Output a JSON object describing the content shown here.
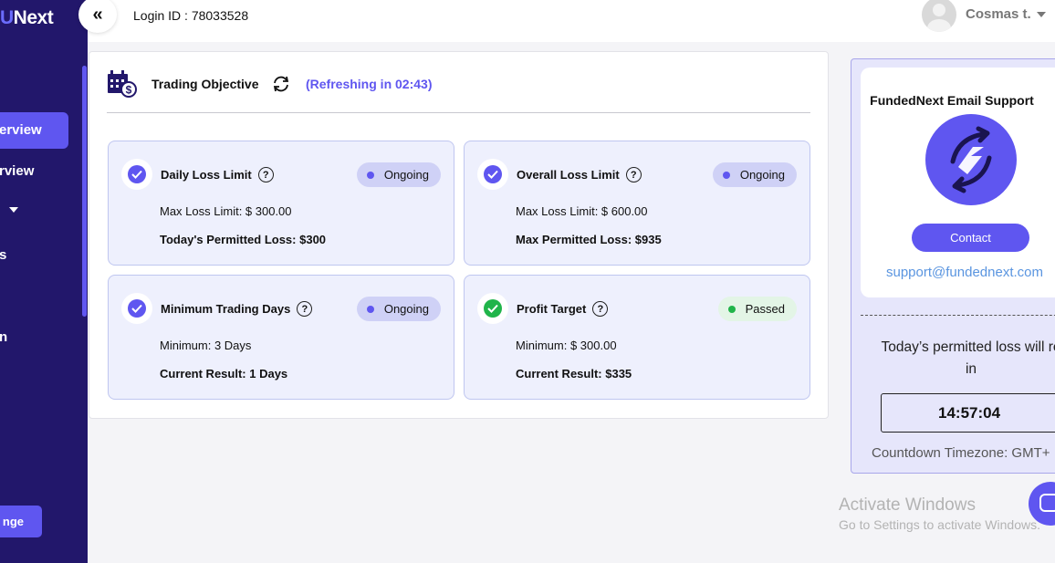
{
  "sidebar": {
    "logo_prefix": "U",
    "logo_text": "Next",
    "items": [
      {
        "label": "erview"
      },
      {
        "label": "rview"
      },
      {
        "label": "s"
      },
      {
        "label": "n"
      }
    ],
    "bottom_button": "nge"
  },
  "header": {
    "collapse_icon": "«",
    "login_label": "Login ID : 78033528",
    "username": "Cosmas t."
  },
  "objectives": {
    "title": "Trading Objective",
    "refresh_text": "(Refreshing in 02:43)",
    "cards": [
      {
        "title": "Daily Loss Limit",
        "status": "Ongoing",
        "line1": "Max Loss Limit: $ 300.00",
        "line2": "Today's Permitted Loss: $300"
      },
      {
        "title": "Overall Loss Limit",
        "status": "Ongoing",
        "line1": "Max Loss Limit: $ 600.00",
        "line2": "Max Permitted Loss: $935"
      },
      {
        "title": "Minimum Trading Days",
        "status": "Ongoing",
        "line1": "Minimum: 3 Days",
        "line2": "Current Result: 1 Days"
      },
      {
        "title": "Profit Target",
        "status": "Passed",
        "line1": "Minimum: $ 300.00",
        "line2": "Current Result: $335"
      }
    ]
  },
  "support": {
    "title": "FundedNext Email Support",
    "contact_label": "Contact",
    "email": "support@fundednext.com",
    "reset_text_1": "Today’s permitted loss will re",
    "reset_text_2": "in",
    "countdown": "14:57:04",
    "timezone": "Countdown Timezone: GMT+"
  },
  "watermark": {
    "line1": "Activate Windows",
    "line2": "Go to Settings to activate Windows."
  },
  "colors": {
    "sidebar_bg": "#22176b",
    "accent": "#5f56f0",
    "card_bg": "#eef0fd",
    "passed_green": "#20b44a"
  }
}
